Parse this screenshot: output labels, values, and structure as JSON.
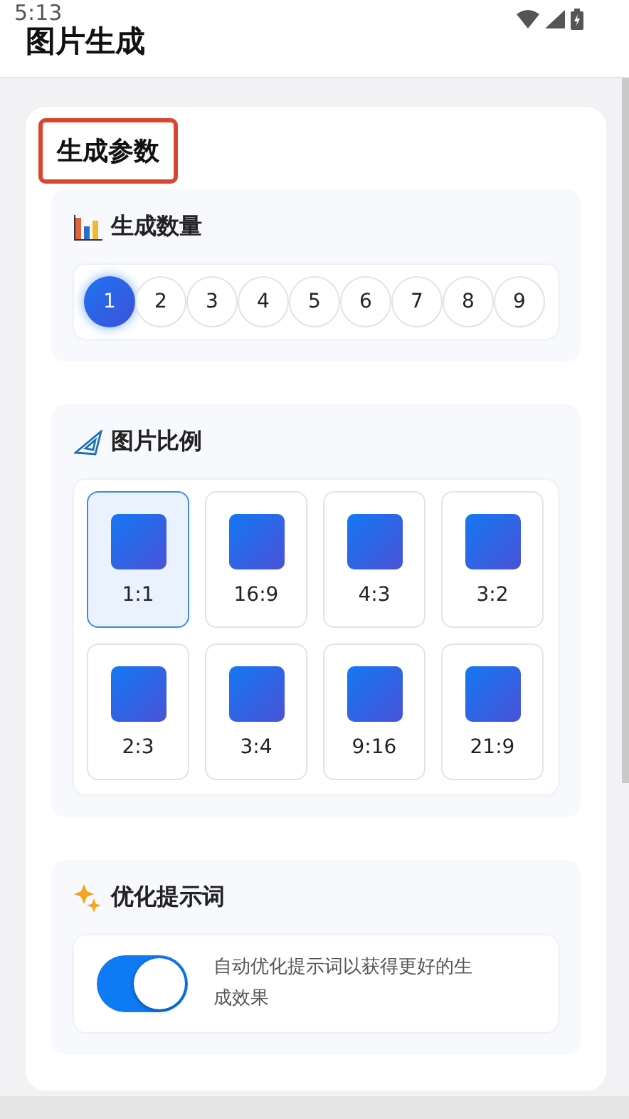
{
  "status_bar": {
    "time": "5:13"
  },
  "header": {
    "title": "图片生成"
  },
  "card": {
    "title": "生成参数",
    "highlighted": true
  },
  "count_section": {
    "title": "生成数量",
    "options": [
      {
        "label": "1",
        "selected": true
      },
      {
        "label": "2",
        "selected": false
      },
      {
        "label": "3",
        "selected": false
      },
      {
        "label": "4",
        "selected": false
      },
      {
        "label": "5",
        "selected": false
      },
      {
        "label": "6",
        "selected": false
      },
      {
        "label": "7",
        "selected": false
      },
      {
        "label": "8",
        "selected": false
      },
      {
        "label": "9",
        "selected": false
      }
    ]
  },
  "ratio_section": {
    "title": "图片比例",
    "options": [
      {
        "label": "1:1",
        "selected": true
      },
      {
        "label": "16:9",
        "selected": false
      },
      {
        "label": "4:3",
        "selected": false
      },
      {
        "label": "3:2",
        "selected": false
      },
      {
        "label": "2:3",
        "selected": false
      },
      {
        "label": "3:4",
        "selected": false
      },
      {
        "label": "9:16",
        "selected": false
      },
      {
        "label": "21:9",
        "selected": false
      }
    ]
  },
  "optimize_section": {
    "title": "优化提示词",
    "toggle": {
      "on": true,
      "label": "自动优化提示词以获得更好的生成效果"
    }
  }
}
